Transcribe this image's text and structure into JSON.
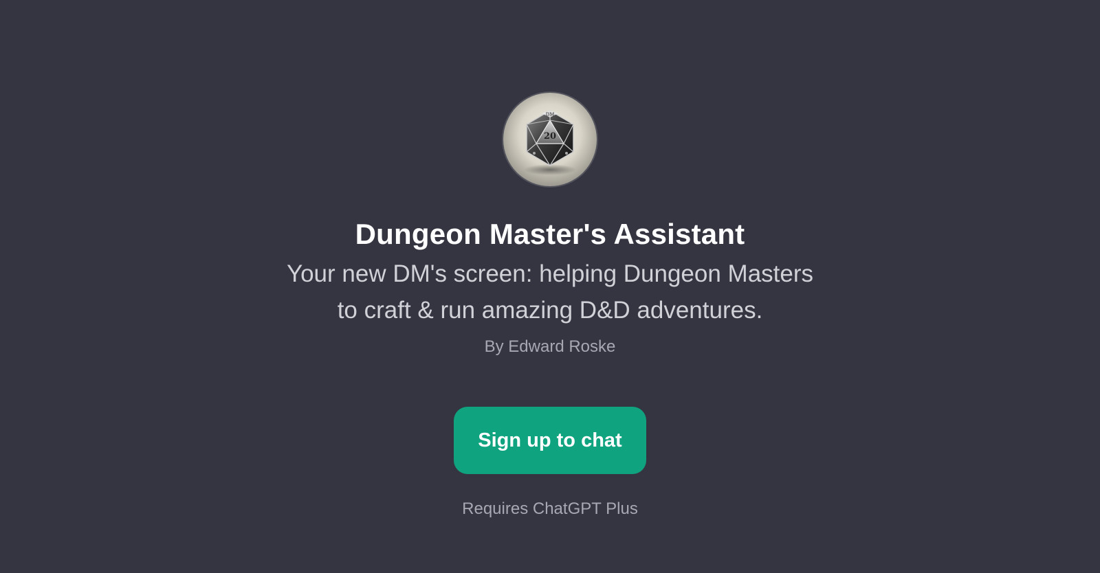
{
  "gpt": {
    "avatar_icon": "d20-die-icon",
    "title": "Dungeon Master's Assistant",
    "description_lines": [
      "Your new DM's screen: helping Dungeon Masters",
      "to craft & run amazing D&D adventures."
    ],
    "author": "By Edward Roske"
  },
  "cta": {
    "label": "Sign up to chat",
    "color": "#10a37f"
  },
  "requirement": "Requires ChatGPT Plus",
  "theme": {
    "background": "#343541"
  }
}
